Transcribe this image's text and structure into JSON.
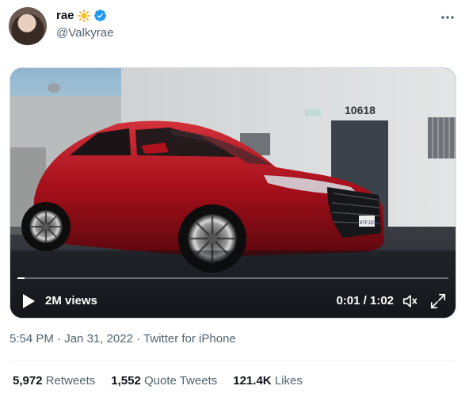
{
  "author": {
    "display_name": "rae",
    "handle": "@Valkyrae",
    "name_emoji": "sun-icon",
    "badge": "verified-icon",
    "badge_color": "#1d9bf0"
  },
  "menu_icon": "more-icon",
  "video": {
    "building_number": "10618",
    "license_plate": "8TFJ235",
    "views": "2M views",
    "time": "0:01 / 1:02",
    "progress": 0.016,
    "icons": [
      "play-icon",
      "volume-icon",
      "fullscreen-icon"
    ]
  },
  "tweet": {
    "time": "5:54 PM",
    "separator1": " · ",
    "date": "Jan 31, 2022",
    "separator2": " · ",
    "source": "Twitter for iPhone"
  },
  "stats": [
    {
      "count": "5,972",
      "label": "Retweets"
    },
    {
      "count": "1,552",
      "label": "Quote Tweets"
    },
    {
      "count": "121.4K",
      "label": "Likes"
    }
  ],
  "colors": {
    "accent": "#1d9bf0",
    "secondary_text": "#536471",
    "car_red": "#b0121d"
  }
}
